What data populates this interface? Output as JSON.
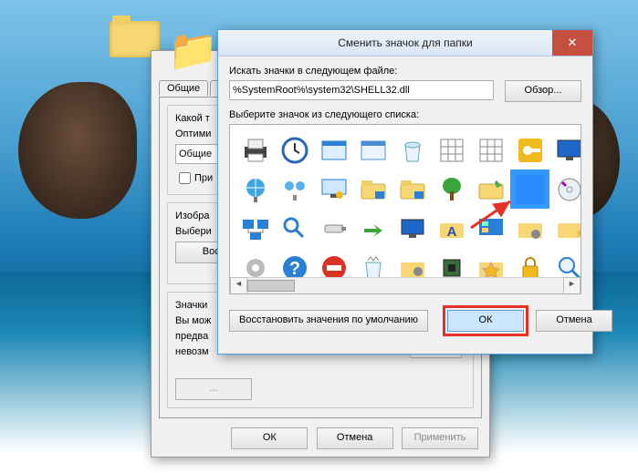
{
  "iconDialog": {
    "title": "Сменить значок для папки",
    "searchLabel": "Искать значки в следующем файле:",
    "path": "%SystemRoot%\\system32\\SHELL32.dll",
    "browse": "Обзор...",
    "listLabel": "Выберите значок из следующего списка:",
    "restore": "Восстановить значения по умолчанию",
    "ok": "ОК",
    "cancel": "Отмена"
  },
  "propDialog": {
    "tab1": "Общие",
    "tab2": "Д",
    "g1_q": "Какой т",
    "g1_opt": "Оптими",
    "g1_btn": "Общие",
    "g1_check": "При",
    "g2_title": "Изобра",
    "g2_line": "Выбери",
    "g2_btn": "Восс",
    "g3_title": "Значки",
    "g3_l1": "Вы мож",
    "g3_l2": "предва",
    "g3_l3": "невозм",
    "ok": "ОК",
    "cancel": "Отмена",
    "apply": "Применить"
  }
}
